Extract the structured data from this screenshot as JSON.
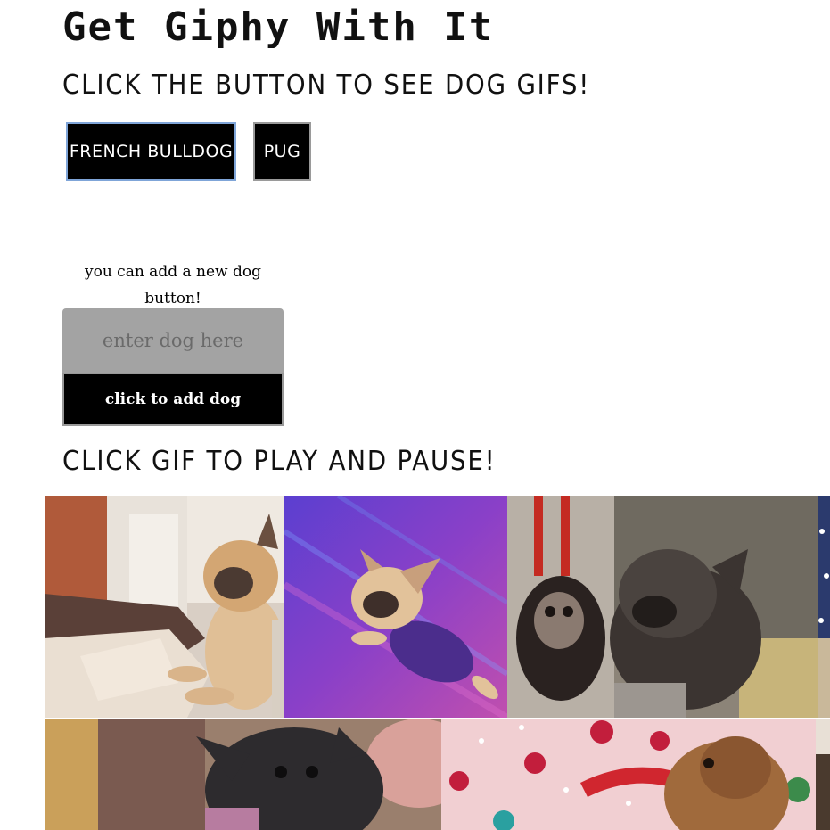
{
  "header": {
    "title": "Get Giphy With It",
    "subtitle": "Click the button to see dog gifs!"
  },
  "dog_buttons": [
    {
      "label": "French Bulldog"
    },
    {
      "label": "Pug"
    }
  ],
  "add_form": {
    "label": "you can add a new dog button!",
    "input_placeholder": "enter dog here",
    "input_value": "",
    "submit_label": "click to add dog"
  },
  "gif_section": {
    "heading": "Click gif to play and pause!"
  },
  "gifs": [
    {
      "subject": "french bulldog sitting on bed"
    },
    {
      "subject": "french bulldog flying on purple background"
    },
    {
      "subject": "baby orangutan with french bulldog"
    },
    {
      "subject": "partially visible gif"
    },
    {
      "subject": "black french bulldog"
    },
    {
      "subject": "pug with red ribbon and ornaments"
    },
    {
      "subject": "partially visible gif"
    }
  ],
  "colors": {
    "button_bg": "#000000",
    "button_text": "#ffffff",
    "input_bg": "#a3a3a3",
    "active_button_border": "#7fa5d8"
  }
}
